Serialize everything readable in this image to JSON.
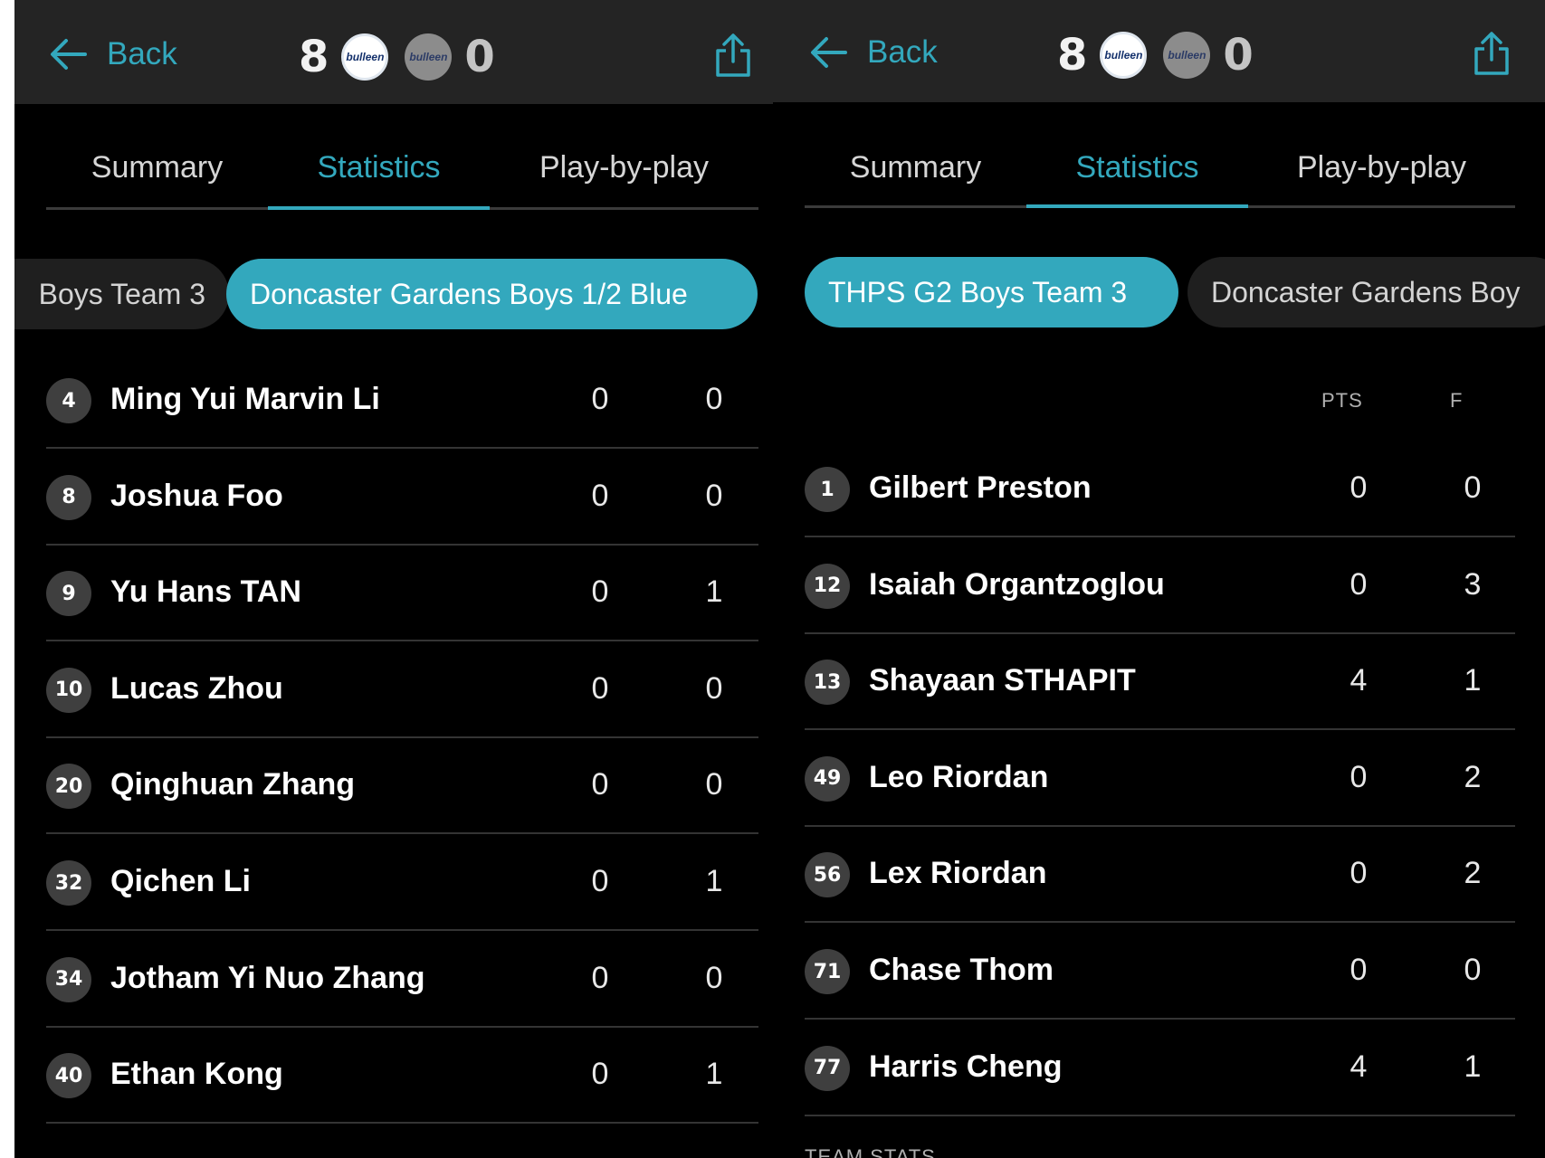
{
  "left_panel": {
    "back_label": "Back",
    "home_score": "8",
    "away_score": "0",
    "home_logo_text": "bulleen",
    "away_logo_text": "bulleen",
    "tabs": [
      "Summary",
      "Statistics",
      "Play-by-play"
    ],
    "active_tab": "Statistics",
    "team_pills": [
      "Boys Team 3",
      "Doncaster Gardens Boys 1/2 Blue"
    ],
    "players": [
      {
        "number": "4",
        "name": "Ming Yui Marvin Li",
        "pts": "0",
        "f": "0"
      },
      {
        "number": "8",
        "name": "Joshua Foo",
        "pts": "0",
        "f": "0"
      },
      {
        "number": "9",
        "name": "Yu Hans TAN",
        "pts": "0",
        "f": "1"
      },
      {
        "number": "10",
        "name": "Lucas Zhou",
        "pts": "0",
        "f": "0"
      },
      {
        "number": "20",
        "name": "Qinghuan Zhang",
        "pts": "0",
        "f": "0"
      },
      {
        "number": "32",
        "name": "Qichen Li",
        "pts": "0",
        "f": "1"
      },
      {
        "number": "34",
        "name": "Jotham Yi Nuo Zhang",
        "pts": "0",
        "f": "0"
      },
      {
        "number": "40",
        "name": "Ethan Kong",
        "pts": "0",
        "f": "1"
      }
    ]
  },
  "right_panel": {
    "back_label": "Back",
    "home_score": "8",
    "away_score": "0",
    "home_logo_text": "bulleen",
    "away_logo_text": "bulleen",
    "tabs": [
      "Summary",
      "Statistics",
      "Play-by-play"
    ],
    "active_tab": "Statistics",
    "team_pills": [
      "THPS G2 Boys Team 3",
      "Doncaster Gardens Boy"
    ],
    "columns": {
      "pts": "PTS",
      "f": "F"
    },
    "players": [
      {
        "number": "1",
        "name": "Gilbert Preston",
        "pts": "0",
        "f": "0"
      },
      {
        "number": "12",
        "name": "Isaiah Organtzoglou",
        "pts": "0",
        "f": "3"
      },
      {
        "number": "13",
        "name": "Shayaan STHAPIT",
        "pts": "4",
        "f": "1"
      },
      {
        "number": "49",
        "name": "Leo Riordan",
        "pts": "0",
        "f": "2"
      },
      {
        "number": "56",
        "name": "Lex Riordan",
        "pts": "0",
        "f": "2"
      },
      {
        "number": "71",
        "name": "Chase Thom",
        "pts": "0",
        "f": "0"
      },
      {
        "number": "77",
        "name": "Harris Cheng",
        "pts": "4",
        "f": "1"
      }
    ],
    "team_stats_label": "TEAM STATS"
  },
  "colors": {
    "accent": "#33a8bd",
    "header_bg": "#242424",
    "badge_bg": "#3f3f3f",
    "divider": "#343434"
  },
  "icons": {
    "back": "arrow-left-icon",
    "share": "share-icon"
  }
}
